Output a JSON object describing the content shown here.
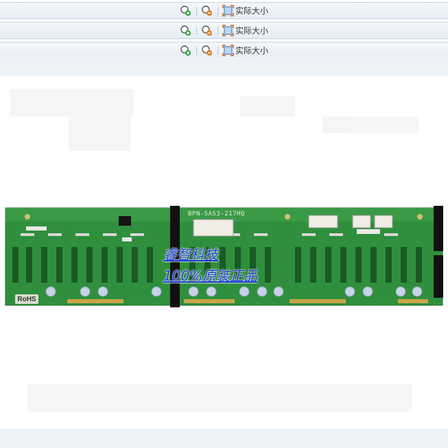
{
  "toolbars": [
    {
      "zoom_in_icon": "zoom-in-icon",
      "zoom_out_icon": "zoom-out-icon",
      "actual_size_icon": "actual-size-icon",
      "actual_size_label": "实际大小"
    },
    {
      "zoom_in_icon": "zoom-in-icon",
      "zoom_out_icon": "zoom-out-icon",
      "actual_size_icon": "actual-size-icon",
      "actual_size_label": "实际大小"
    },
    {
      "zoom_in_icon": "zoom-in-icon",
      "zoom_out_icon": "zoom-out-icon",
      "actual_size_icon": "actual-size-icon",
      "actual_size_label": "实际大小"
    }
  ],
  "image": {
    "watermark_line1": "睿智科技",
    "watermark_line2": "100%原装正品",
    "board_model": "BPN-SAS3-217HQ",
    "board_marking": "RoHS"
  },
  "colors": {
    "pcb_green": "#2f8f3c",
    "toolbar_bg": "#e8eef5",
    "watermark": "#1a3fd8"
  }
}
